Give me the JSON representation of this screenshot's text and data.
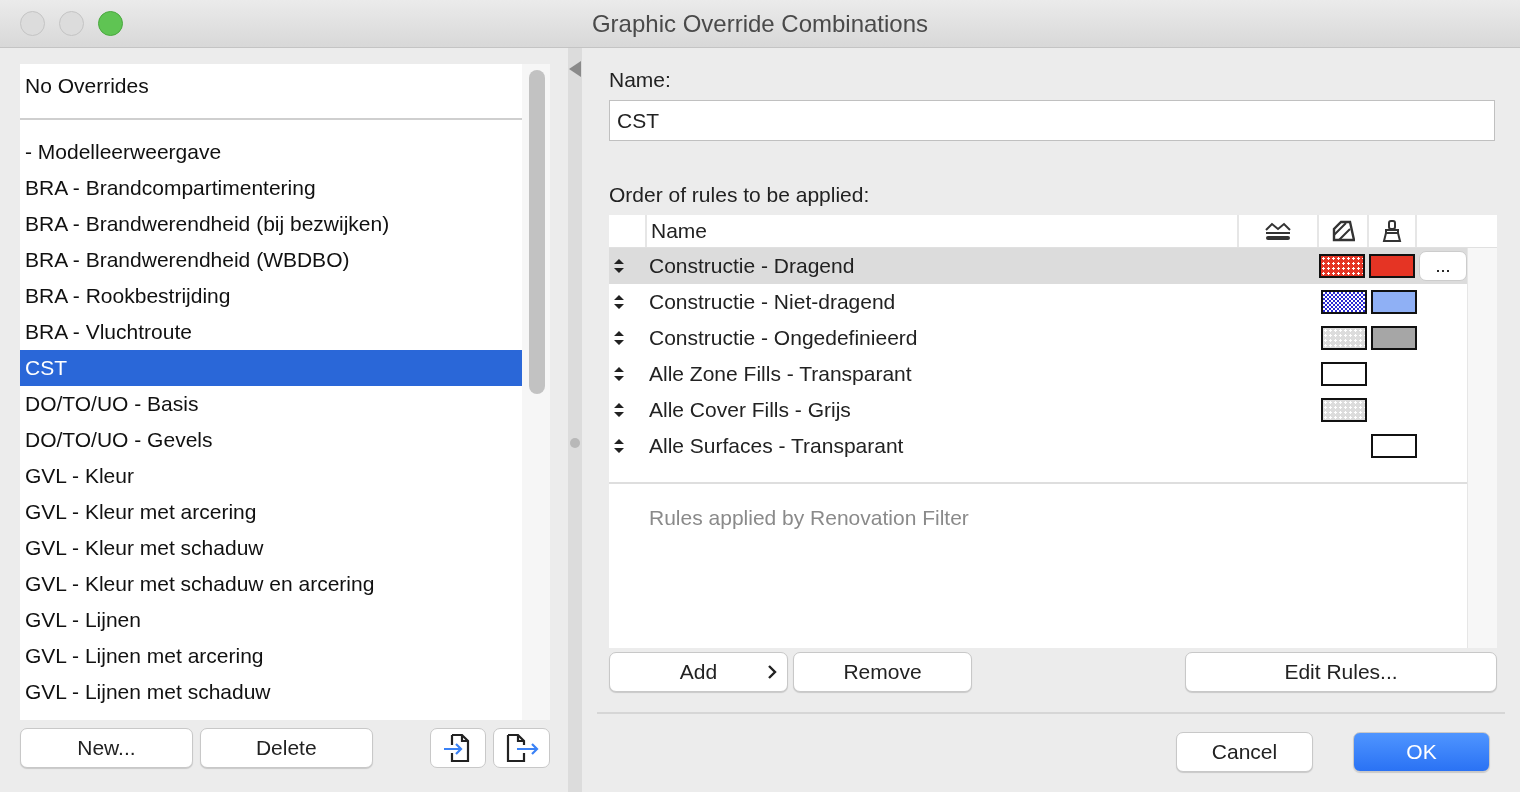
{
  "window": {
    "title": "Graphic Override Combinations"
  },
  "combinations": {
    "fixed_item": {
      "label": "No Overrides",
      "selected": false
    },
    "items": [
      {
        "label": "- Modelleerweergave",
        "selected": false
      },
      {
        "label": "BRA - Brandcompartimentering",
        "selected": false
      },
      {
        "label": "BRA - Brandwerendheid (bij bezwijken)",
        "selected": false
      },
      {
        "label": "BRA - Brandwerendheid (WBDBO)",
        "selected": false
      },
      {
        "label": "BRA - Rookbestrijding",
        "selected": false
      },
      {
        "label": "BRA - Vluchtroute",
        "selected": false
      },
      {
        "label": "CST",
        "selected": true
      },
      {
        "label": "DO/TO/UO - Basis",
        "selected": false
      },
      {
        "label": "DO/TO/UO - Gevels",
        "selected": false
      },
      {
        "label": "GVL - Kleur",
        "selected": false
      },
      {
        "label": "GVL - Kleur met arcering",
        "selected": false
      },
      {
        "label": "GVL - Kleur met schaduw",
        "selected": false
      },
      {
        "label": "GVL - Kleur met schaduw en arcering",
        "selected": false
      },
      {
        "label": "GVL - Lijnen",
        "selected": false
      },
      {
        "label": "GVL - Lijnen met arcering",
        "selected": false
      },
      {
        "label": "GVL - Lijnen met schaduw",
        "selected": false
      }
    ],
    "buttons": [
      "New...",
      "Delete"
    ]
  },
  "name_field": {
    "label": "Name:",
    "value": "CST"
  },
  "rules": {
    "label": "Order of rules to be applied:",
    "columns": [
      "Name"
    ],
    "rows": [
      {
        "name": "Constructie - Dragend",
        "selected": true,
        "fill": {
          "color": "#e53424",
          "kind": "dots"
        },
        "surface": {
          "color": "#e53424"
        },
        "more": "..."
      },
      {
        "name": "Constructie - Niet-dragend",
        "selected": false,
        "fill": {
          "color": "#2a2ad0",
          "kind": "checker"
        },
        "surface": {
          "color": "#8fb0f5"
        }
      },
      {
        "name": "Constructie - Ongedefinieerd",
        "selected": false,
        "fill": {
          "color": "#dcdcdc",
          "kind": "dots"
        },
        "surface": {
          "color": "#a6a6a6"
        }
      },
      {
        "name": "Alle Zone Fills - Transparant",
        "selected": false,
        "fill": {
          "color": "#ffffff",
          "kind": "solid"
        }
      },
      {
        "name": "Alle Cover Fills - Grijs",
        "selected": false,
        "fill": {
          "color": "#dcdcdc",
          "kind": "dots"
        }
      },
      {
        "name": "Alle Surfaces - Transparant",
        "selected": false,
        "surface": {
          "color": "#ffffff"
        }
      }
    ],
    "renovation_note": "Rules applied by Renovation Filter",
    "buttons": [
      "Add",
      "Remove",
      "Edit Rules..."
    ]
  },
  "footer_buttons": [
    {
      "label": "Cancel",
      "kind": "normal"
    },
    {
      "label": "OK",
      "kind": "default"
    }
  ]
}
